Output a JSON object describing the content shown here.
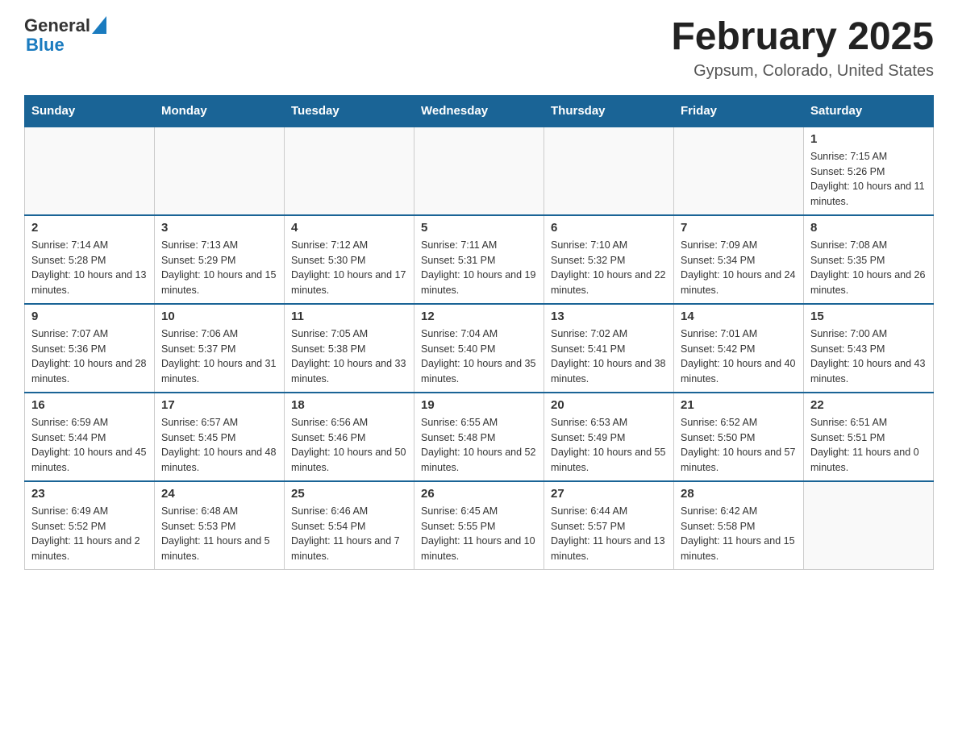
{
  "header": {
    "logo_general": "General",
    "logo_blue": "Blue",
    "title": "February 2025",
    "location": "Gypsum, Colorado, United States"
  },
  "weekdays": [
    "Sunday",
    "Monday",
    "Tuesday",
    "Wednesday",
    "Thursday",
    "Friday",
    "Saturday"
  ],
  "weeks": [
    [
      {
        "day": "",
        "sunrise": "",
        "sunset": "",
        "daylight": ""
      },
      {
        "day": "",
        "sunrise": "",
        "sunset": "",
        "daylight": ""
      },
      {
        "day": "",
        "sunrise": "",
        "sunset": "",
        "daylight": ""
      },
      {
        "day": "",
        "sunrise": "",
        "sunset": "",
        "daylight": ""
      },
      {
        "day": "",
        "sunrise": "",
        "sunset": "",
        "daylight": ""
      },
      {
        "day": "",
        "sunrise": "",
        "sunset": "",
        "daylight": ""
      },
      {
        "day": "1",
        "sunrise": "Sunrise: 7:15 AM",
        "sunset": "Sunset: 5:26 PM",
        "daylight": "Daylight: 10 hours and 11 minutes."
      }
    ],
    [
      {
        "day": "2",
        "sunrise": "Sunrise: 7:14 AM",
        "sunset": "Sunset: 5:28 PM",
        "daylight": "Daylight: 10 hours and 13 minutes."
      },
      {
        "day": "3",
        "sunrise": "Sunrise: 7:13 AM",
        "sunset": "Sunset: 5:29 PM",
        "daylight": "Daylight: 10 hours and 15 minutes."
      },
      {
        "day": "4",
        "sunrise": "Sunrise: 7:12 AM",
        "sunset": "Sunset: 5:30 PM",
        "daylight": "Daylight: 10 hours and 17 minutes."
      },
      {
        "day": "5",
        "sunrise": "Sunrise: 7:11 AM",
        "sunset": "Sunset: 5:31 PM",
        "daylight": "Daylight: 10 hours and 19 minutes."
      },
      {
        "day": "6",
        "sunrise": "Sunrise: 7:10 AM",
        "sunset": "Sunset: 5:32 PM",
        "daylight": "Daylight: 10 hours and 22 minutes."
      },
      {
        "day": "7",
        "sunrise": "Sunrise: 7:09 AM",
        "sunset": "Sunset: 5:34 PM",
        "daylight": "Daylight: 10 hours and 24 minutes."
      },
      {
        "day": "8",
        "sunrise": "Sunrise: 7:08 AM",
        "sunset": "Sunset: 5:35 PM",
        "daylight": "Daylight: 10 hours and 26 minutes."
      }
    ],
    [
      {
        "day": "9",
        "sunrise": "Sunrise: 7:07 AM",
        "sunset": "Sunset: 5:36 PM",
        "daylight": "Daylight: 10 hours and 28 minutes."
      },
      {
        "day": "10",
        "sunrise": "Sunrise: 7:06 AM",
        "sunset": "Sunset: 5:37 PM",
        "daylight": "Daylight: 10 hours and 31 minutes."
      },
      {
        "day": "11",
        "sunrise": "Sunrise: 7:05 AM",
        "sunset": "Sunset: 5:38 PM",
        "daylight": "Daylight: 10 hours and 33 minutes."
      },
      {
        "day": "12",
        "sunrise": "Sunrise: 7:04 AM",
        "sunset": "Sunset: 5:40 PM",
        "daylight": "Daylight: 10 hours and 35 minutes."
      },
      {
        "day": "13",
        "sunrise": "Sunrise: 7:02 AM",
        "sunset": "Sunset: 5:41 PM",
        "daylight": "Daylight: 10 hours and 38 minutes."
      },
      {
        "day": "14",
        "sunrise": "Sunrise: 7:01 AM",
        "sunset": "Sunset: 5:42 PM",
        "daylight": "Daylight: 10 hours and 40 minutes."
      },
      {
        "day": "15",
        "sunrise": "Sunrise: 7:00 AM",
        "sunset": "Sunset: 5:43 PM",
        "daylight": "Daylight: 10 hours and 43 minutes."
      }
    ],
    [
      {
        "day": "16",
        "sunrise": "Sunrise: 6:59 AM",
        "sunset": "Sunset: 5:44 PM",
        "daylight": "Daylight: 10 hours and 45 minutes."
      },
      {
        "day": "17",
        "sunrise": "Sunrise: 6:57 AM",
        "sunset": "Sunset: 5:45 PM",
        "daylight": "Daylight: 10 hours and 48 minutes."
      },
      {
        "day": "18",
        "sunrise": "Sunrise: 6:56 AM",
        "sunset": "Sunset: 5:46 PM",
        "daylight": "Daylight: 10 hours and 50 minutes."
      },
      {
        "day": "19",
        "sunrise": "Sunrise: 6:55 AM",
        "sunset": "Sunset: 5:48 PM",
        "daylight": "Daylight: 10 hours and 52 minutes."
      },
      {
        "day": "20",
        "sunrise": "Sunrise: 6:53 AM",
        "sunset": "Sunset: 5:49 PM",
        "daylight": "Daylight: 10 hours and 55 minutes."
      },
      {
        "day": "21",
        "sunrise": "Sunrise: 6:52 AM",
        "sunset": "Sunset: 5:50 PM",
        "daylight": "Daylight: 10 hours and 57 minutes."
      },
      {
        "day": "22",
        "sunrise": "Sunrise: 6:51 AM",
        "sunset": "Sunset: 5:51 PM",
        "daylight": "Daylight: 11 hours and 0 minutes."
      }
    ],
    [
      {
        "day": "23",
        "sunrise": "Sunrise: 6:49 AM",
        "sunset": "Sunset: 5:52 PM",
        "daylight": "Daylight: 11 hours and 2 minutes."
      },
      {
        "day": "24",
        "sunrise": "Sunrise: 6:48 AM",
        "sunset": "Sunset: 5:53 PM",
        "daylight": "Daylight: 11 hours and 5 minutes."
      },
      {
        "day": "25",
        "sunrise": "Sunrise: 6:46 AM",
        "sunset": "Sunset: 5:54 PM",
        "daylight": "Daylight: 11 hours and 7 minutes."
      },
      {
        "day": "26",
        "sunrise": "Sunrise: 6:45 AM",
        "sunset": "Sunset: 5:55 PM",
        "daylight": "Daylight: 11 hours and 10 minutes."
      },
      {
        "day": "27",
        "sunrise": "Sunrise: 6:44 AM",
        "sunset": "Sunset: 5:57 PM",
        "daylight": "Daylight: 11 hours and 13 minutes."
      },
      {
        "day": "28",
        "sunrise": "Sunrise: 6:42 AM",
        "sunset": "Sunset: 5:58 PM",
        "daylight": "Daylight: 11 hours and 15 minutes."
      },
      {
        "day": "",
        "sunrise": "",
        "sunset": "",
        "daylight": ""
      }
    ]
  ]
}
